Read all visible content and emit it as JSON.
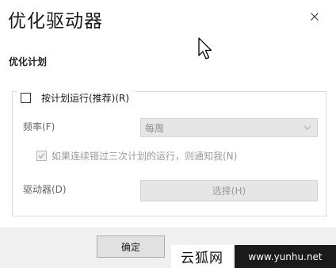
{
  "dialog": {
    "title": "优化驱动器",
    "close_icon": "close-icon"
  },
  "section": {
    "title": "优化计划"
  },
  "schedule": {
    "checkbox_label": "按计划运行(推荐)(R)",
    "checked": false
  },
  "frequency": {
    "label": "频率(F)",
    "value": "每周"
  },
  "notify": {
    "label": "如果连续错过三次计划的运行，则通知我(N)",
    "checked": true
  },
  "drives": {
    "label": "驱动器(D)",
    "button": "选择(H)"
  },
  "footer": {
    "ok_button": "确定"
  },
  "watermark": {
    "left": "云狐网",
    "right": "www.yunhu.net"
  },
  "colors": {
    "disabled_fill": "#e6e6e6",
    "disabled_text": "#9a9a9a",
    "footer_bg": "#f0f0f0"
  }
}
